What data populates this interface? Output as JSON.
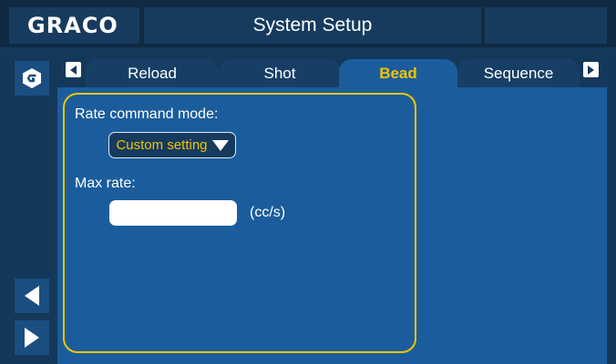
{
  "header": {
    "brand": "GRACO",
    "title": "System Setup"
  },
  "rail": {
    "home_icon": "graco-home-icon",
    "back_icon": "back-arrow-icon",
    "forward_icon": "forward-arrow-icon"
  },
  "tabs": {
    "prev_icon": "tab-prev-arrow-icon",
    "next_icon": "tab-next-arrow-icon",
    "items": [
      {
        "label": "Reload",
        "active": false
      },
      {
        "label": "Shot",
        "active": false
      },
      {
        "label": "Bead",
        "active": true
      },
      {
        "label": "Sequence",
        "active": false
      }
    ]
  },
  "form": {
    "rate_mode_label": "Rate command mode:",
    "rate_mode_value": "Custom setting",
    "max_rate_label": "Max rate:",
    "max_rate_value": "",
    "max_rate_unit": "(cc/s)"
  },
  "colors": {
    "accent": "#f2c400",
    "active_tab": "#1b5d9c",
    "inactive_tab": "#173f66",
    "header": "#163b5e",
    "background": "#14385a"
  }
}
